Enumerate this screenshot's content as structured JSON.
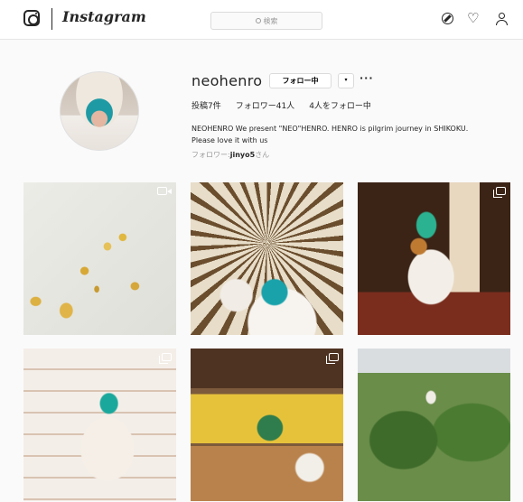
{
  "header": {
    "brand": "Instagram",
    "search_placeholder": "検索",
    "icons": [
      "instagram-glyph-icon",
      "search-icon",
      "explore-compass-icon",
      "heart-icon",
      "profile-icon"
    ]
  },
  "profile": {
    "username": "neohenro",
    "follow_button": "フォロー中",
    "dropdown_label": "▾",
    "more_label": "···",
    "stats": {
      "posts": "投稿7件",
      "followers": "フォロワー41人",
      "following": "4人をフォロー中"
    },
    "bio_line1": "NEOHENRO We present \"NEO\"HENRO. HENRO is pilgrim journey in SHIKOKU.",
    "bio_line2": "Please love it with us",
    "followed_by_prefix": "フォロワー:",
    "followed_by_user": "jinyo5",
    "followed_by_suffix": "さん"
  },
  "posts": [
    {
      "badge": "video"
    },
    {
      "badge": "none"
    },
    {
      "badge": "multiple"
    },
    {
      "badge": "multiple"
    },
    {
      "badge": "multiple"
    },
    {
      "badge": "none"
    }
  ]
}
